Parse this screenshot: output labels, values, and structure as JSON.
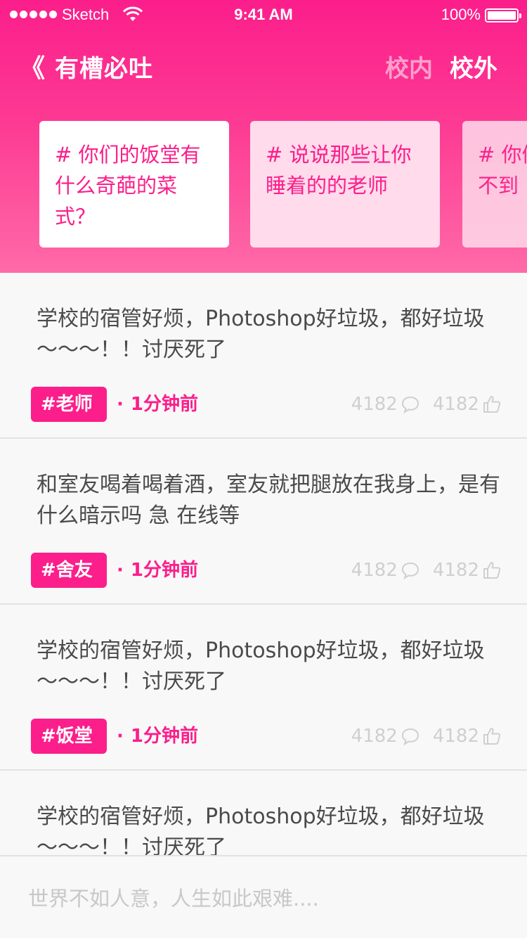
{
  "status_bar": {
    "carrier": "Sketch",
    "time": "9:41 AM",
    "battery": "100%"
  },
  "nav": {
    "back_icon": "《",
    "title": "有槽必吐",
    "tabs": [
      {
        "label": "校内",
        "active": false
      },
      {
        "label": "校外",
        "active": true
      }
    ]
  },
  "topics": [
    {
      "text": "# 你们的饭堂有什么奇葩的菜式？"
    },
    {
      "text": "# 说说那些让你睡着的的老师"
    },
    {
      "text": "# 你们做过最想不到"
    }
  ],
  "posts": [
    {
      "text": "学校的宿管好烦，Photoshop好垃圾，都好垃圾～～～！！讨厌死了",
      "tag": "#老师",
      "time": "1分钟前",
      "comments": "4182",
      "likes": "4182"
    },
    {
      "text": "和室友喝着喝着酒，室友就把腿放在我身上，是有什么暗示吗 急 在线等",
      "tag": "#舍友",
      "time": "1分钟前",
      "comments": "4182",
      "likes": "4182"
    },
    {
      "text": "学校的宿管好烦，Photoshop好垃圾，都好垃圾～～～！！讨厌死了",
      "tag": "#饭堂",
      "time": "1分钟前",
      "comments": "4182",
      "likes": "4182"
    },
    {
      "text": "学校的宿管好烦，Photoshop好垃圾，都好垃圾～～～！！讨厌死了",
      "tag": "",
      "time": "",
      "comments": "",
      "likes": ""
    }
  ],
  "meta_dot": "·",
  "input": {
    "placeholder": "世界不如人意，人生如此艰难...."
  },
  "colors": {
    "accent": "#fb1e8b",
    "muted": "#cfcfcf",
    "text": "#4a4a4a"
  },
  "icons": [
    "wifi-icon",
    "battery-icon",
    "back-icon",
    "comment-icon",
    "like-icon"
  ]
}
